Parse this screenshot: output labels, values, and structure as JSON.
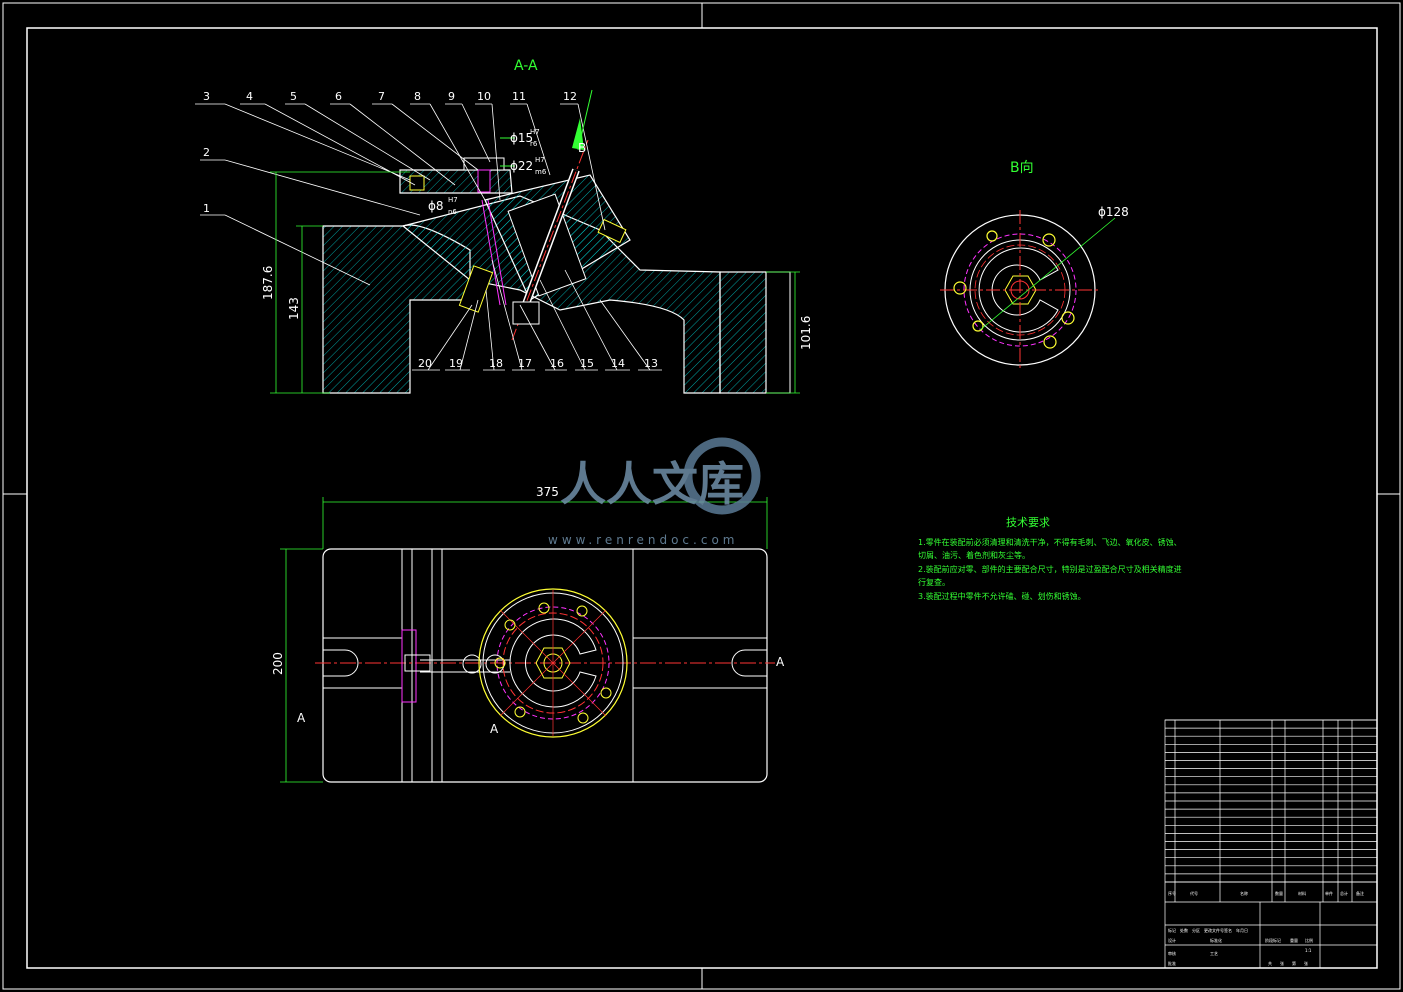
{
  "section_view": {
    "title": "A-A",
    "part_numbers": [
      "1",
      "2",
      "3",
      "4",
      "5",
      "6",
      "7",
      "8",
      "9",
      "10",
      "11",
      "12",
      "13",
      "14",
      "15",
      "16",
      "17",
      "18",
      "19",
      "20"
    ],
    "section_arrow": "B",
    "dims": {
      "phi15": "ϕ15",
      "phi15_fit_top": "H7",
      "phi15_fit_bot": "r6",
      "phi22": "ϕ22",
      "phi22_fit_top": "H7",
      "phi22_fit_bot": "m6",
      "phi8": "ϕ8",
      "phi8_fit_top": "H7",
      "phi8_fit_bot": "n6",
      "h1": "187.6",
      "h2": "143",
      "h3": "101.6"
    }
  },
  "b_view": {
    "title": "B向",
    "dim": "ϕ128"
  },
  "plan_view": {
    "width_dim": "375",
    "height_dim": "200",
    "section_mark_left": "A",
    "section_mark_right": "A",
    "cut_mark": "A"
  },
  "tech_requirements": {
    "title": "技术要求",
    "items": [
      "1.零件在装配前必须清理和清洗干净，不得有毛刺、飞边、氧化皮、锈蚀、切屑、油污、着色剂和灰尘等。",
      "2.装配前应对零、部件的主要配合尺寸，特别是过盈配合尺寸及相关精度进行复查。",
      "3.装配过程中零件不允许磕、碰、划伤和锈蚀。"
    ]
  },
  "watermark": {
    "brand": "人人文库",
    "url": "www.renrendoc.com"
  },
  "title_block": {
    "header": [
      "序号",
      "代号",
      "名称",
      "数量",
      "材料",
      "单件",
      "总计",
      "备注"
    ],
    "bottom_left": [
      "标记",
      "处数",
      "分区",
      "更改文件号",
      "签名",
      "年月日"
    ],
    "bottom_mid": [
      "阶段标记",
      "重量",
      "比例"
    ],
    "bottom_labels": [
      "设计",
      "标准化",
      "审核",
      "工艺",
      "批准"
    ],
    "scale": "1:1",
    "sheet": [
      "共",
      "张",
      "第",
      "张"
    ]
  },
  "colors": {
    "background": "#000000",
    "outline": "#ffffff",
    "dimension": "#33ff33",
    "hatch": "#00ffff",
    "centerline": "#ff3333",
    "hidden": "#ff33ff",
    "text": "#ffffff",
    "watermark": "#5a7a95"
  }
}
